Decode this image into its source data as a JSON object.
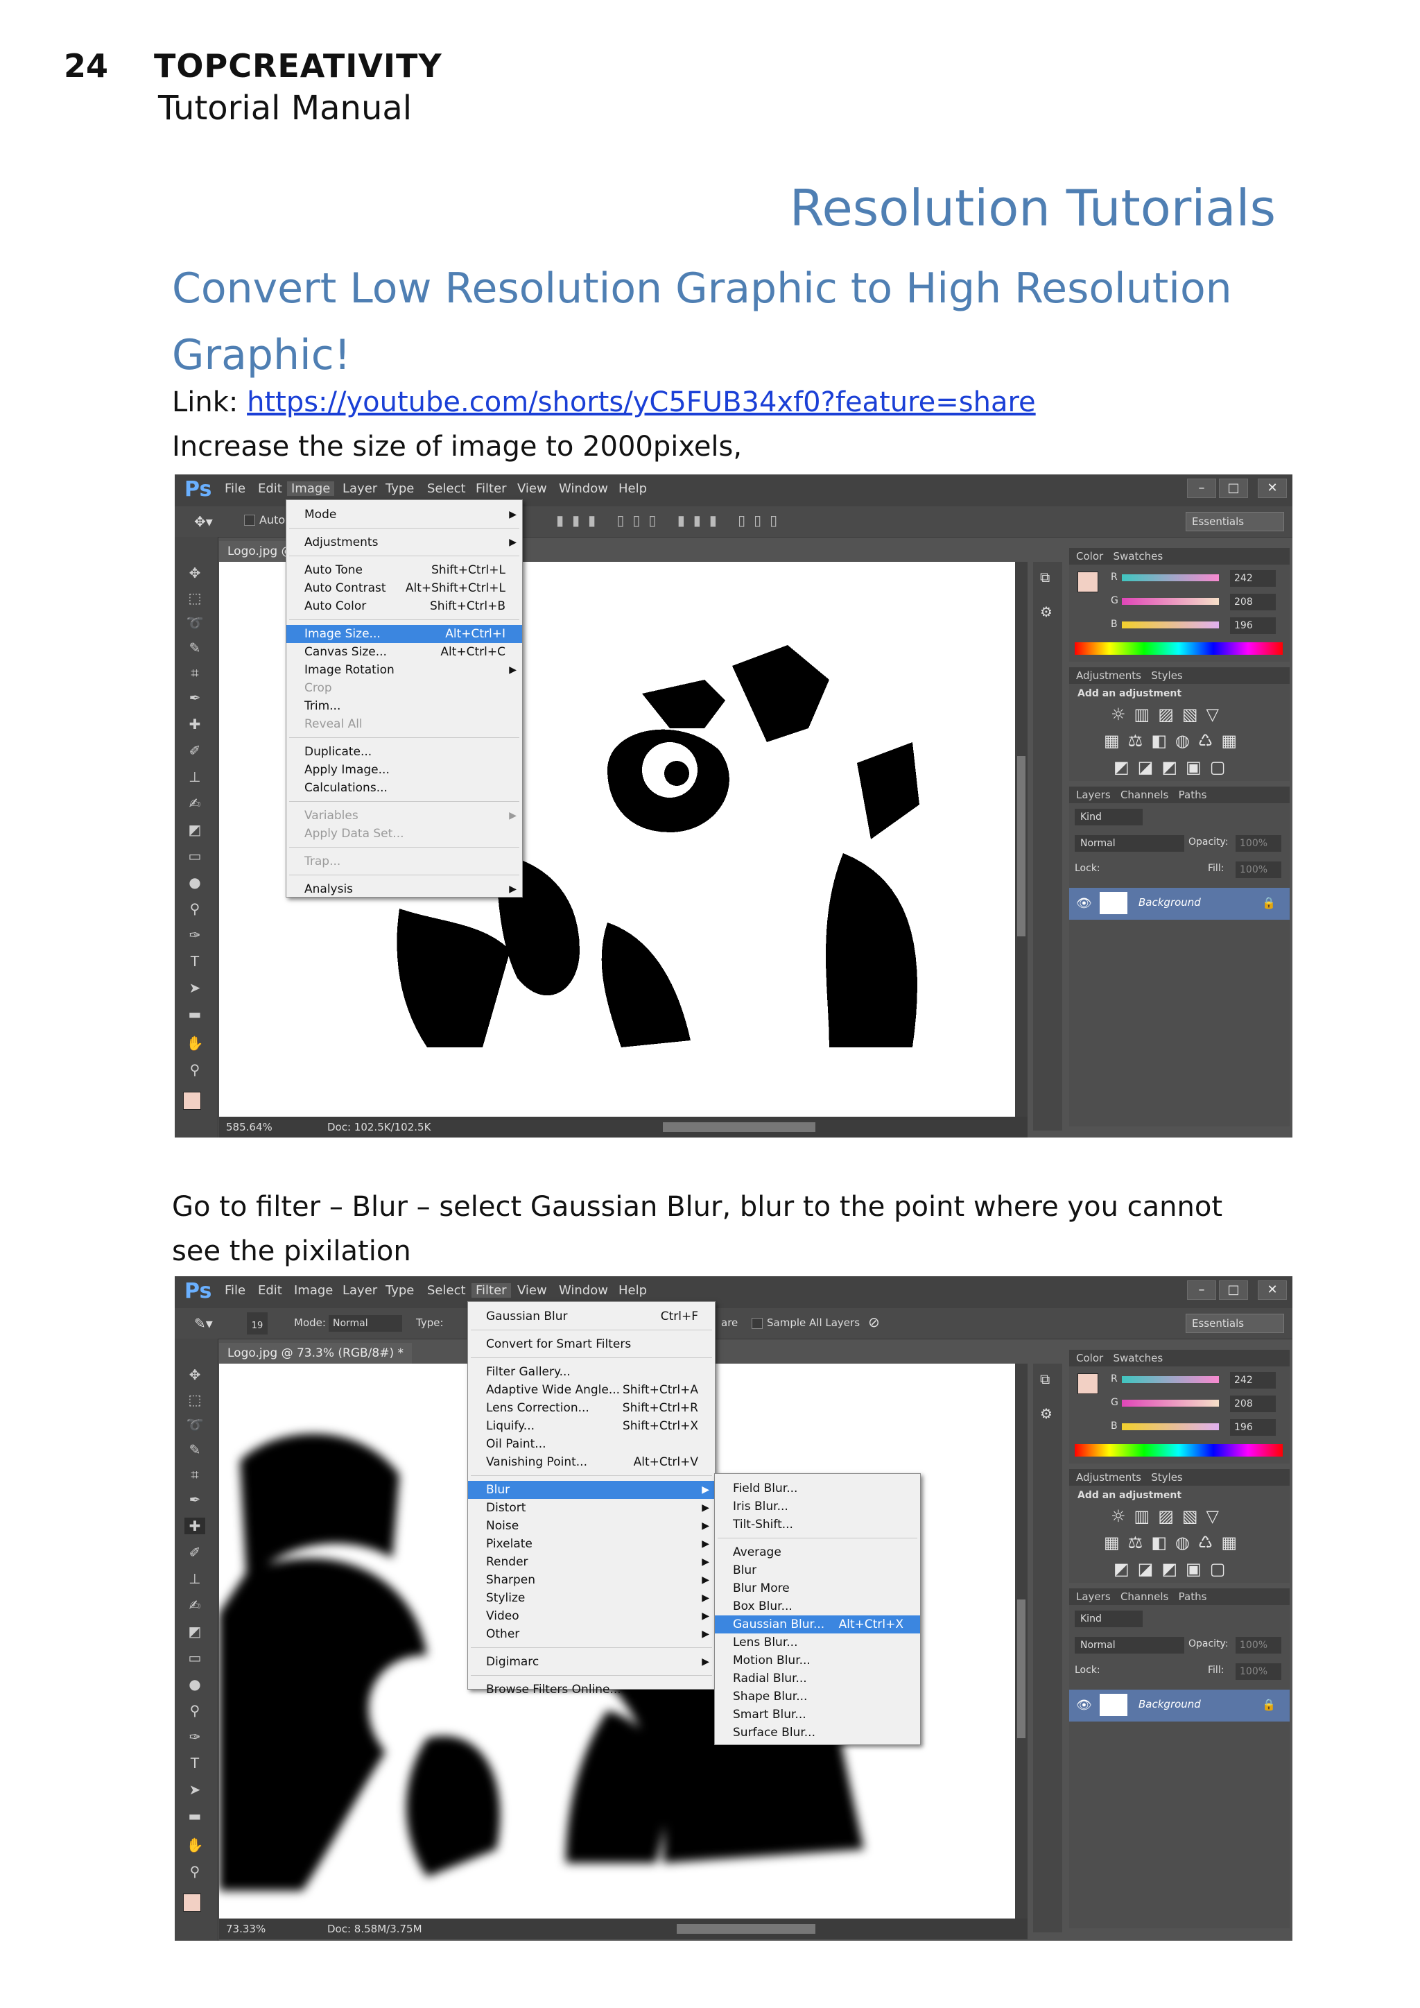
{
  "header": {
    "page_number": "24",
    "brand": "TOPCREATIVITY",
    "subtitle": "Tutorial Manual"
  },
  "section_title": "Resolution Tutorials",
  "heading": "Convert Low Resolution Graphic to High Resolution Graphic!",
  "link_label": "Link: ",
  "link_url": "https://youtube.com/shorts/yC5FUB34xf0?feature=share",
  "step1": "Increase the size of image to 2000pixels,",
  "step2": "Go to filter – Blur – select Gaussian Blur, blur to the point where you cannot see the pixilation",
  "app": {
    "logo": "Ps",
    "menus": [
      "File",
      "Edit",
      "Image",
      "Layer",
      "Type",
      "Select",
      "Filter",
      "View",
      "Window",
      "Help"
    ],
    "workspace": "Essentials",
    "win_buttons": [
      "–",
      "□",
      "✕"
    ]
  },
  "shot1": {
    "tab": "Logo.jpg @",
    "opt_text": "Auto-",
    "status_zoom": "585.64%",
    "status_doc": "Doc: 102.5K/102.5K",
    "image_menu": [
      {
        "label": "Mode",
        "arrow": true
      },
      {
        "label": "Adjustments",
        "arrow": true
      },
      {
        "label": "Auto Tone",
        "shortcut": "Shift+Ctrl+L"
      },
      {
        "label": "Auto Contrast",
        "shortcut": "Alt+Shift+Ctrl+L"
      },
      {
        "label": "Auto Color",
        "shortcut": "Shift+Ctrl+B"
      },
      {
        "label": "Image Size...",
        "shortcut": "Alt+Ctrl+I",
        "selected": true
      },
      {
        "label": "Canvas Size...",
        "shortcut": "Alt+Ctrl+C"
      },
      {
        "label": "Image Rotation",
        "arrow": true
      },
      {
        "label": "Crop",
        "disabled": true
      },
      {
        "label": "Trim..."
      },
      {
        "label": "Reveal All",
        "disabled": true
      },
      {
        "label": "Duplicate..."
      },
      {
        "label": "Apply Image..."
      },
      {
        "label": "Calculations..."
      },
      {
        "label": "Variables",
        "arrow": true,
        "disabled": true
      },
      {
        "label": "Apply Data Set...",
        "disabled": true
      },
      {
        "label": "Trap...",
        "disabled": true
      },
      {
        "label": "Analysis",
        "arrow": true
      }
    ]
  },
  "shot2": {
    "tab": "Logo.jpg @ 73.3% (RGB/8#) *",
    "opt_mode_label": "Mode:",
    "opt_mode_value": "Normal",
    "opt_type_label": "Type:",
    "opt_sample": "Sample All Layers",
    "opt_brush_size": "19",
    "opt_fragment": "are",
    "status_zoom": "73.33%",
    "status_doc": "Doc: 8.58M/3.75M",
    "filter_menu": [
      {
        "label": "Gaussian Blur",
        "shortcut": "Ctrl+F"
      },
      {
        "label": "Convert for Smart Filters"
      },
      {
        "label": "Filter Gallery..."
      },
      {
        "label": "Adaptive Wide Angle...",
        "shortcut": "Shift+Ctrl+A"
      },
      {
        "label": "Lens Correction...",
        "shortcut": "Shift+Ctrl+R"
      },
      {
        "label": "Liquify...",
        "shortcut": "Shift+Ctrl+X"
      },
      {
        "label": "Oil Paint..."
      },
      {
        "label": "Vanishing Point...",
        "shortcut": "Alt+Ctrl+V"
      },
      {
        "label": "Blur",
        "arrow": true,
        "selected": true
      },
      {
        "label": "Distort",
        "arrow": true
      },
      {
        "label": "Noise",
        "arrow": true
      },
      {
        "label": "Pixelate",
        "arrow": true
      },
      {
        "label": "Render",
        "arrow": true
      },
      {
        "label": "Sharpen",
        "arrow": true
      },
      {
        "label": "Stylize",
        "arrow": true
      },
      {
        "label": "Video",
        "arrow": true
      },
      {
        "label": "Other",
        "arrow": true
      },
      {
        "label": "Digimarc",
        "arrow": true
      },
      {
        "label": "Browse Filters Online..."
      }
    ],
    "blur_menu": [
      {
        "label": "Field Blur..."
      },
      {
        "label": "Iris Blur..."
      },
      {
        "label": "Tilt-Shift..."
      },
      {
        "label": "Average"
      },
      {
        "label": "Blur"
      },
      {
        "label": "Blur More"
      },
      {
        "label": "Box Blur..."
      },
      {
        "label": "Gaussian Blur...",
        "shortcut": "Alt+Ctrl+X",
        "selected": true
      },
      {
        "label": "Lens Blur..."
      },
      {
        "label": "Motion Blur..."
      },
      {
        "label": "Radial Blur..."
      },
      {
        "label": "Shape Blur..."
      },
      {
        "label": "Smart Blur..."
      },
      {
        "label": "Surface Blur..."
      }
    ]
  },
  "panels": {
    "color_tabs": [
      "Color",
      "Swatches"
    ],
    "rgb_labels": [
      "R",
      "G",
      "B"
    ],
    "rgb_values": [
      "242",
      "208",
      "196"
    ],
    "adj_tabs": [
      "Adjustments",
      "Styles"
    ],
    "adj_hint": "Add an adjustment",
    "layers_tabs": [
      "Layers",
      "Channels",
      "Paths"
    ],
    "kind": "Kind",
    "blend": "Normal",
    "opacity_label": "Opacity:",
    "opacity_value": "100%",
    "lock_label": "Lock:",
    "fill_label": "Fill:",
    "fill_value": "100%",
    "layer_name": "Background"
  },
  "colors": {
    "heading": "#4f7fb3",
    "link": "#1a3fd6",
    "menu_highlight": "#3b86e0",
    "fg_swatch": "#f2d0c4"
  }
}
